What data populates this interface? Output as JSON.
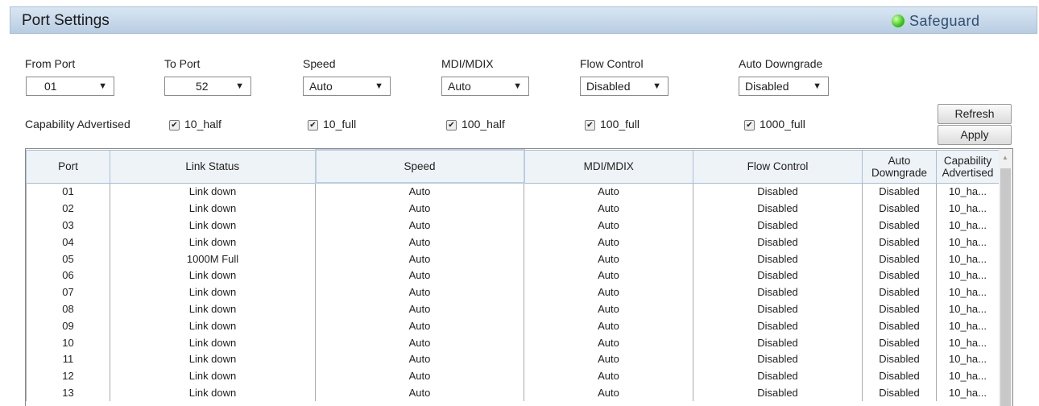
{
  "header": {
    "title": "Port Settings",
    "safeguard": "Safeguard"
  },
  "form": {
    "from_port": {
      "label": "From Port",
      "value": "01"
    },
    "to_port": {
      "label": "To Port",
      "value": "52"
    },
    "speed": {
      "label": "Speed",
      "value": "Auto"
    },
    "mdi": {
      "label": "MDI/MDIX",
      "value": "Auto"
    },
    "flow": {
      "label": "Flow Control",
      "value": "Disabled"
    },
    "auto_down": {
      "label": "Auto Downgrade",
      "value": "Disabled"
    },
    "cap_label": "Capability Advertised",
    "caps": [
      "10_half",
      "10_full",
      "100_half",
      "100_full",
      "1000_full"
    ],
    "refresh": "Refresh",
    "apply": "Apply"
  },
  "table": {
    "headers": [
      "Port",
      "Link Status",
      "Speed",
      "MDI/MDIX",
      "Flow Control",
      "Auto Downgrade",
      "Capability Advertised"
    ],
    "rows": [
      [
        "01",
        "Link down",
        "Auto",
        "Auto",
        "Disabled",
        "Disabled",
        "10_ha..."
      ],
      [
        "02",
        "Link down",
        "Auto",
        "Auto",
        "Disabled",
        "Disabled",
        "10_ha..."
      ],
      [
        "03",
        "Link down",
        "Auto",
        "Auto",
        "Disabled",
        "Disabled",
        "10_ha..."
      ],
      [
        "04",
        "Link down",
        "Auto",
        "Auto",
        "Disabled",
        "Disabled",
        "10_ha..."
      ],
      [
        "05",
        "1000M Full",
        "Auto",
        "Auto",
        "Disabled",
        "Disabled",
        "10_ha..."
      ],
      [
        "06",
        "Link down",
        "Auto",
        "Auto",
        "Disabled",
        "Disabled",
        "10_ha..."
      ],
      [
        "07",
        "Link down",
        "Auto",
        "Auto",
        "Disabled",
        "Disabled",
        "10_ha..."
      ],
      [
        "08",
        "Link down",
        "Auto",
        "Auto",
        "Disabled",
        "Disabled",
        "10_ha..."
      ],
      [
        "09",
        "Link down",
        "Auto",
        "Auto",
        "Disabled",
        "Disabled",
        "10_ha..."
      ],
      [
        "10",
        "Link down",
        "Auto",
        "Auto",
        "Disabled",
        "Disabled",
        "10_ha..."
      ],
      [
        "11",
        "Link down",
        "Auto",
        "Auto",
        "Disabled",
        "Disabled",
        "10_ha..."
      ],
      [
        "12",
        "Link down",
        "Auto",
        "Auto",
        "Disabled",
        "Disabled",
        "10_ha..."
      ],
      [
        "13",
        "Link down",
        "Auto",
        "Auto",
        "Disabled",
        "Disabled",
        "10_ha..."
      ]
    ]
  }
}
